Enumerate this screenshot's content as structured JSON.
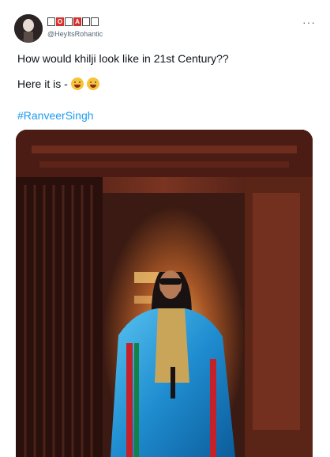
{
  "author": {
    "display_name_glyphs": [
      "",
      "O",
      "",
      "A",
      "",
      ""
    ],
    "handle": "@HeyItsRohantic"
  },
  "tweet": {
    "line1": "How would khilji look like in 21st Century??",
    "line2": "Here it is -",
    "emojis": [
      "face-with-tears-of-joy-icon",
      "loudly-crying-face-icon"
    ],
    "hashtag": "#RanveerSingh"
  },
  "icons": {
    "more": "more-options-icon"
  },
  "colors": {
    "hashtag": "#1d9bf0",
    "handle": "#536471"
  }
}
